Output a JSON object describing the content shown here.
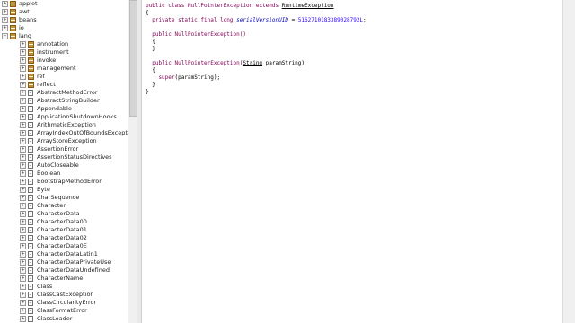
{
  "tree": {
    "rows": [
      {
        "label": "applet",
        "kind": "pkg",
        "depth": 1,
        "exp": "+"
      },
      {
        "label": "awt",
        "kind": "pkg",
        "depth": 1,
        "exp": "+"
      },
      {
        "label": "beans",
        "kind": "pkg",
        "depth": 1,
        "exp": "+"
      },
      {
        "label": "io",
        "kind": "pkg",
        "depth": 1,
        "exp": "+"
      },
      {
        "label": "lang",
        "kind": "pkg",
        "depth": 1,
        "exp": "−"
      },
      {
        "label": "annotation",
        "kind": "pkg",
        "depth": 2,
        "exp": "+"
      },
      {
        "label": "instrument",
        "kind": "pkg",
        "depth": 2,
        "exp": "+"
      },
      {
        "label": "invoke",
        "kind": "pkg",
        "depth": 2,
        "exp": "+"
      },
      {
        "label": "management",
        "kind": "pkg",
        "depth": 2,
        "exp": "+"
      },
      {
        "label": "ref",
        "kind": "pkg",
        "depth": 2,
        "exp": "+"
      },
      {
        "label": "reflect",
        "kind": "pkg",
        "depth": 2,
        "exp": "+"
      },
      {
        "label": "AbstractMethodError",
        "kind": "cls",
        "depth": 2,
        "exp": "+"
      },
      {
        "label": "AbstractStringBuilder",
        "kind": "cls",
        "depth": 2,
        "exp": "+"
      },
      {
        "label": "Appendable",
        "kind": "cls",
        "depth": 2,
        "exp": "+"
      },
      {
        "label": "ApplicationShutdownHooks",
        "kind": "cls",
        "depth": 2,
        "exp": "+"
      },
      {
        "label": "ArithmeticException",
        "kind": "cls",
        "depth": 2,
        "exp": "+"
      },
      {
        "label": "ArrayIndexOutOfBoundsException",
        "kind": "cls",
        "depth": 2,
        "exp": "+"
      },
      {
        "label": "ArrayStoreException",
        "kind": "cls",
        "depth": 2,
        "exp": "+"
      },
      {
        "label": "AssertionError",
        "kind": "cls",
        "depth": 2,
        "exp": "+"
      },
      {
        "label": "AssertionStatusDirectives",
        "kind": "cls",
        "depth": 2,
        "exp": "+"
      },
      {
        "label": "AutoCloseable",
        "kind": "cls",
        "depth": 2,
        "exp": "+"
      },
      {
        "label": "Boolean",
        "kind": "cls",
        "depth": 2,
        "exp": "+"
      },
      {
        "label": "BootstrapMethodError",
        "kind": "cls",
        "depth": 2,
        "exp": "+"
      },
      {
        "label": "Byte",
        "kind": "cls",
        "depth": 2,
        "exp": "+"
      },
      {
        "label": "CharSequence",
        "kind": "cls",
        "depth": 2,
        "exp": "+"
      },
      {
        "label": "Character",
        "kind": "cls",
        "depth": 2,
        "exp": "+"
      },
      {
        "label": "CharacterData",
        "kind": "cls",
        "depth": 2,
        "exp": "+"
      },
      {
        "label": "CharacterData00",
        "kind": "cls",
        "depth": 2,
        "exp": "+"
      },
      {
        "label": "CharacterData01",
        "kind": "cls",
        "depth": 2,
        "exp": "+"
      },
      {
        "label": "CharacterData02",
        "kind": "cls",
        "depth": 2,
        "exp": "+"
      },
      {
        "label": "CharacterData0E",
        "kind": "cls",
        "depth": 2,
        "exp": "+"
      },
      {
        "label": "CharacterDataLatin1",
        "kind": "cls",
        "depth": 2,
        "exp": "+"
      },
      {
        "label": "CharacterDataPrivateUse",
        "kind": "cls",
        "depth": 2,
        "exp": "+"
      },
      {
        "label": "CharacterDataUndefined",
        "kind": "cls",
        "depth": 2,
        "exp": "+"
      },
      {
        "label": "CharacterName",
        "kind": "cls",
        "depth": 2,
        "exp": "+"
      },
      {
        "label": "Class",
        "kind": "cls",
        "depth": 2,
        "exp": "+"
      },
      {
        "label": "ClassCastException",
        "kind": "cls",
        "depth": 2,
        "exp": "+"
      },
      {
        "label": "ClassCircularityError",
        "kind": "cls",
        "depth": 2,
        "exp": "+"
      },
      {
        "label": "ClassFormatError",
        "kind": "cls",
        "depth": 2,
        "exp": "+"
      },
      {
        "label": "ClassLoader",
        "kind": "cls",
        "depth": 2,
        "exp": "+"
      }
    ],
    "class_icon_glyph": "J"
  },
  "code": {
    "lines": [
      [
        {
          "t": "public class NullPointerException ",
          "c": "kw"
        },
        {
          "t": "extends ",
          "c": "kw"
        },
        {
          "t": "RuntimeException",
          "c": "type"
        }
      ],
      [
        {
          "t": "{",
          "c": ""
        }
      ],
      [
        {
          "t": "  private static final long ",
          "c": "kw"
        },
        {
          "t": "serialVersionUID",
          "c": "fld"
        },
        {
          "t": " = ",
          "c": ""
        },
        {
          "t": "5162710183389028792L",
          "c": "num"
        },
        {
          "t": ";",
          "c": ""
        }
      ],
      [
        {
          "t": "",
          "c": ""
        }
      ],
      [
        {
          "t": "  public NullPointerException()",
          "c": "kw"
        }
      ],
      [
        {
          "t": "  {",
          "c": ""
        }
      ],
      [
        {
          "t": "  }",
          "c": ""
        }
      ],
      [
        {
          "t": "",
          "c": ""
        }
      ],
      [
        {
          "t": "  public NullPointerException(",
          "c": "kw"
        },
        {
          "t": "String",
          "c": "type"
        },
        {
          "t": " paramString)",
          "c": ""
        }
      ],
      [
        {
          "t": "  {",
          "c": ""
        }
      ],
      [
        {
          "t": "    super",
          "c": "kw"
        },
        {
          "t": "(paramString);",
          "c": ""
        }
      ],
      [
        {
          "t": "  }",
          "c": ""
        }
      ],
      [
        {
          "t": "}",
          "c": ""
        }
      ]
    ]
  },
  "colors": {
    "keyword": "#7f0055",
    "field": "#0000c0",
    "number": "#2a00ff"
  }
}
